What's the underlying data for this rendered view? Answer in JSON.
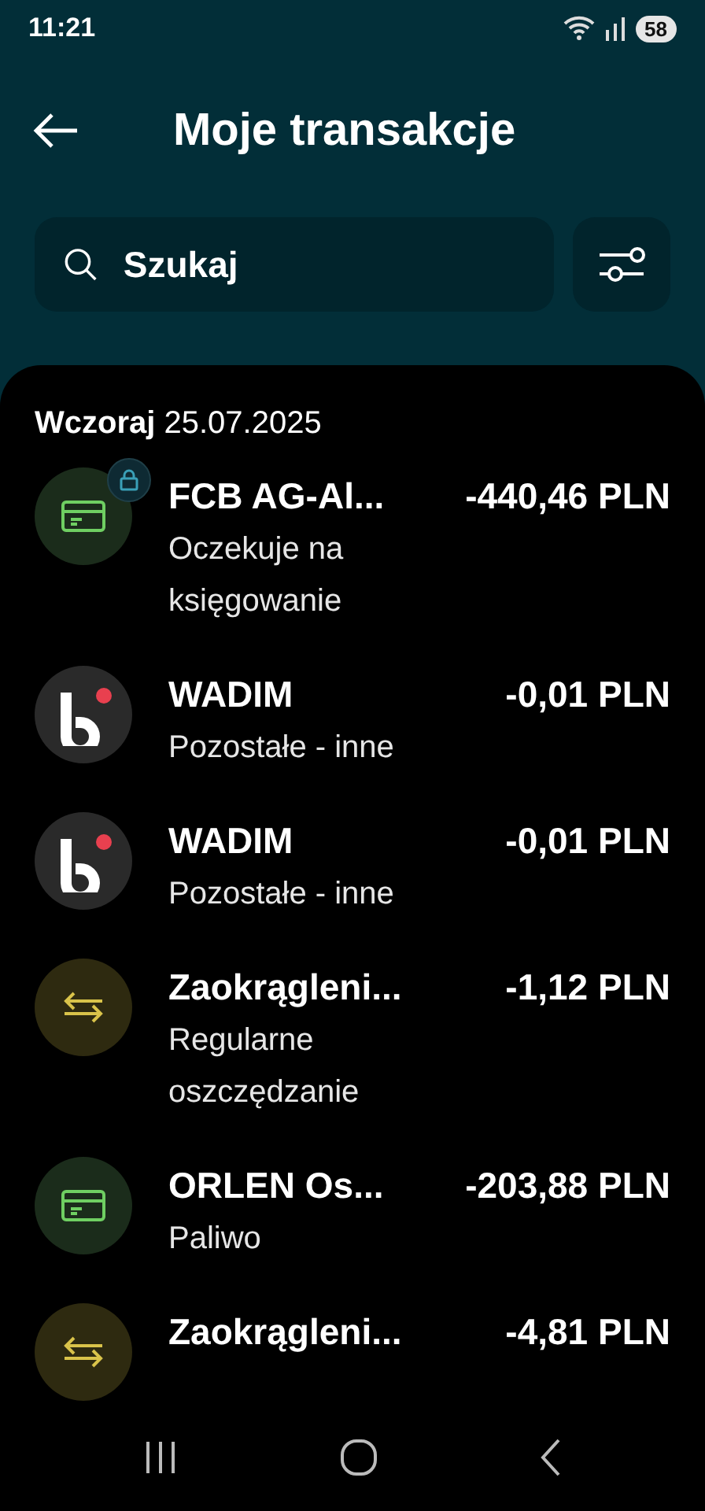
{
  "status_bar": {
    "time": "11:21",
    "battery": "58"
  },
  "header": {
    "title": "Moje transakcje"
  },
  "search": {
    "placeholder": "Szukaj"
  },
  "groups": [
    {
      "date_label": "Wczoraj",
      "date": "25.07.2025",
      "transactions": [
        {
          "kind": "card",
          "locked": true,
          "title": "FCB AG-Al...",
          "subtitle": "Oczekuje na księgowanie",
          "amount": "-440,46 PLN"
        },
        {
          "kind": "app",
          "locked": false,
          "title": "WADIM",
          "subtitle": "Pozostałe - inne",
          "amount": "-0,01 PLN"
        },
        {
          "kind": "app",
          "locked": false,
          "title": "WADIM",
          "subtitle": "Pozostałe - inne",
          "amount": "-0,01 PLN"
        },
        {
          "kind": "transfer",
          "locked": false,
          "title": "Zaokrągleni...",
          "subtitle": "Regularne oszczędzanie",
          "amount": "-1,12 PLN"
        },
        {
          "kind": "card",
          "locked": false,
          "title": "ORLEN Os...",
          "subtitle": "Paliwo",
          "amount": "-203,88 PLN"
        },
        {
          "kind": "transfer",
          "locked": false,
          "title": "Zaokrągleni...",
          "amount": "-4,81 PLN"
        }
      ]
    }
  ]
}
